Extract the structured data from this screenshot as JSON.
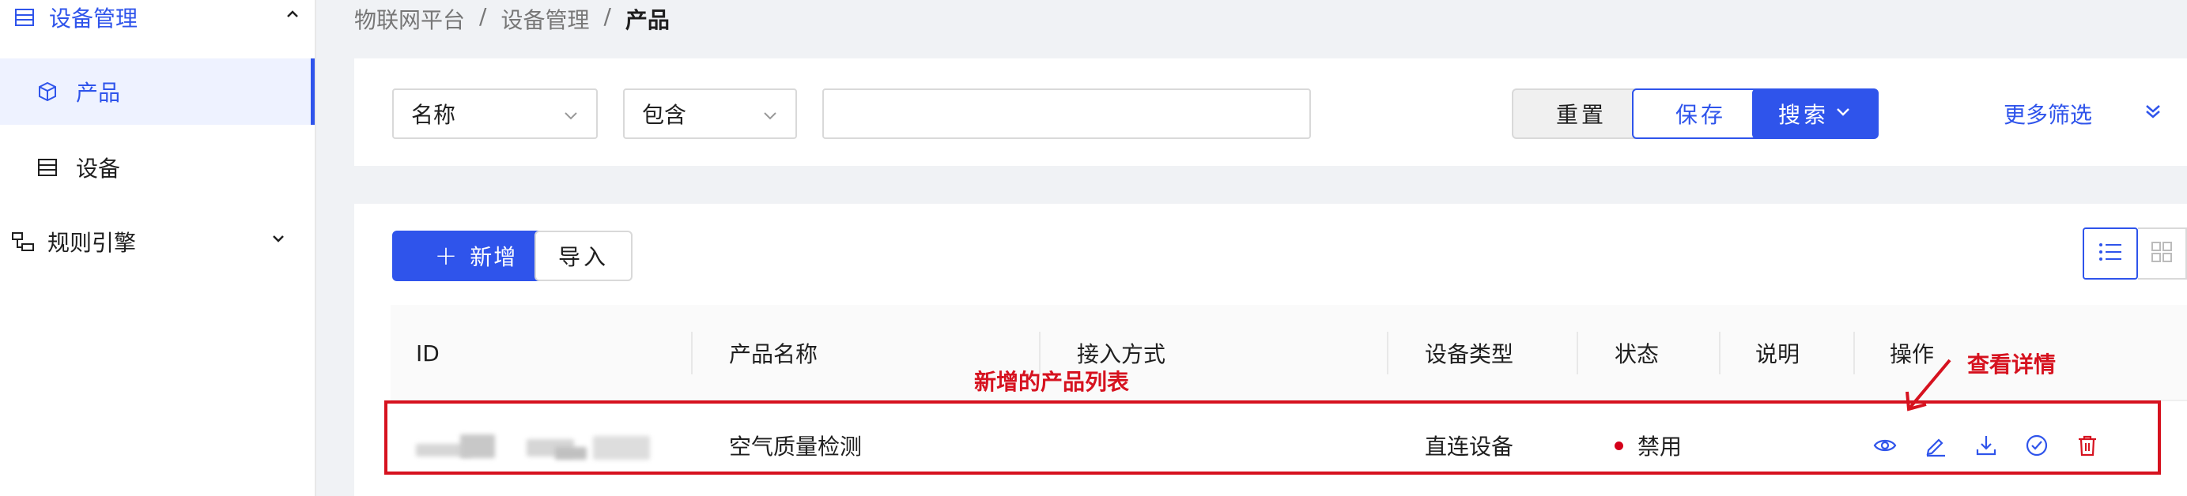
{
  "sidebar": {
    "group_device": "设备管理",
    "item_product": "产品",
    "item_device": "设备",
    "group_rules": "规则引擎"
  },
  "breadcrumb": {
    "root": "物联网平台",
    "sep": "/",
    "level2": "设备管理",
    "current": "产品"
  },
  "filter": {
    "field_select": "名称",
    "operator_select": "包含",
    "value": "",
    "reset_label": "重置",
    "save_label": "保存",
    "search_label": "搜索",
    "more_filter": "更多筛选"
  },
  "toolbar": {
    "add_label": "新增",
    "add_plus": "+",
    "import_label": "导入"
  },
  "table": {
    "columns": [
      "ID",
      "产品名称",
      "接入方式",
      "设备类型",
      "状态",
      "说明",
      "操作"
    ],
    "rows": [
      {
        "id": "",
        "name": "空气质量检测",
        "access": "",
        "device_type": "直连设备",
        "status": "禁用",
        "description": ""
      }
    ]
  },
  "annotations": {
    "list_label": "新增的产品列表",
    "detail_label": "查看详情"
  },
  "colors": {
    "accent": "#2f54eb",
    "danger": "#d6121f",
    "status_disabled": "#d4001a"
  }
}
